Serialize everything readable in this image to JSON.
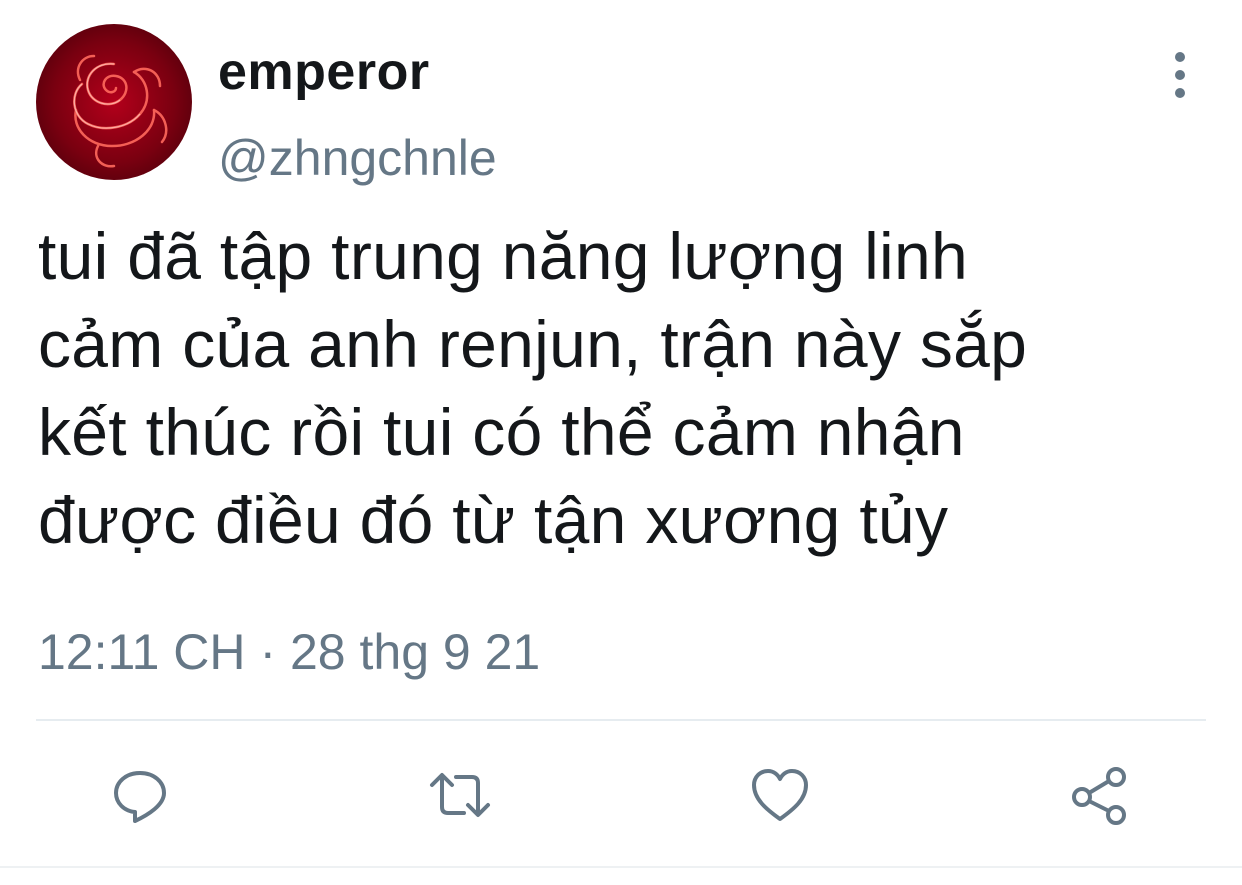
{
  "user": {
    "display_name": "emperor",
    "handle": "@zhngchnle"
  },
  "tweet": {
    "lines": [
      "tui đã tập trung năng lượng linh",
      "cảm của anh renjun, trận này sắp",
      "kết thúc rồi tui có thể cảm nhận",
      "được điều đó từ tận xương tủy"
    ],
    "time": "12:11 CH",
    "separator": "·",
    "date": "28 thg 9 21"
  },
  "icons": {
    "avatar": "rose-neon-avatar",
    "more": "more-vertical-icon",
    "reply": "reply-icon",
    "retweet": "retweet-icon",
    "like": "heart-icon",
    "share": "share-icon"
  },
  "colors": {
    "text": "#14171a",
    "muted": "#657786",
    "divider": "#e6ecf0",
    "avatar_red": "#b3001b"
  }
}
